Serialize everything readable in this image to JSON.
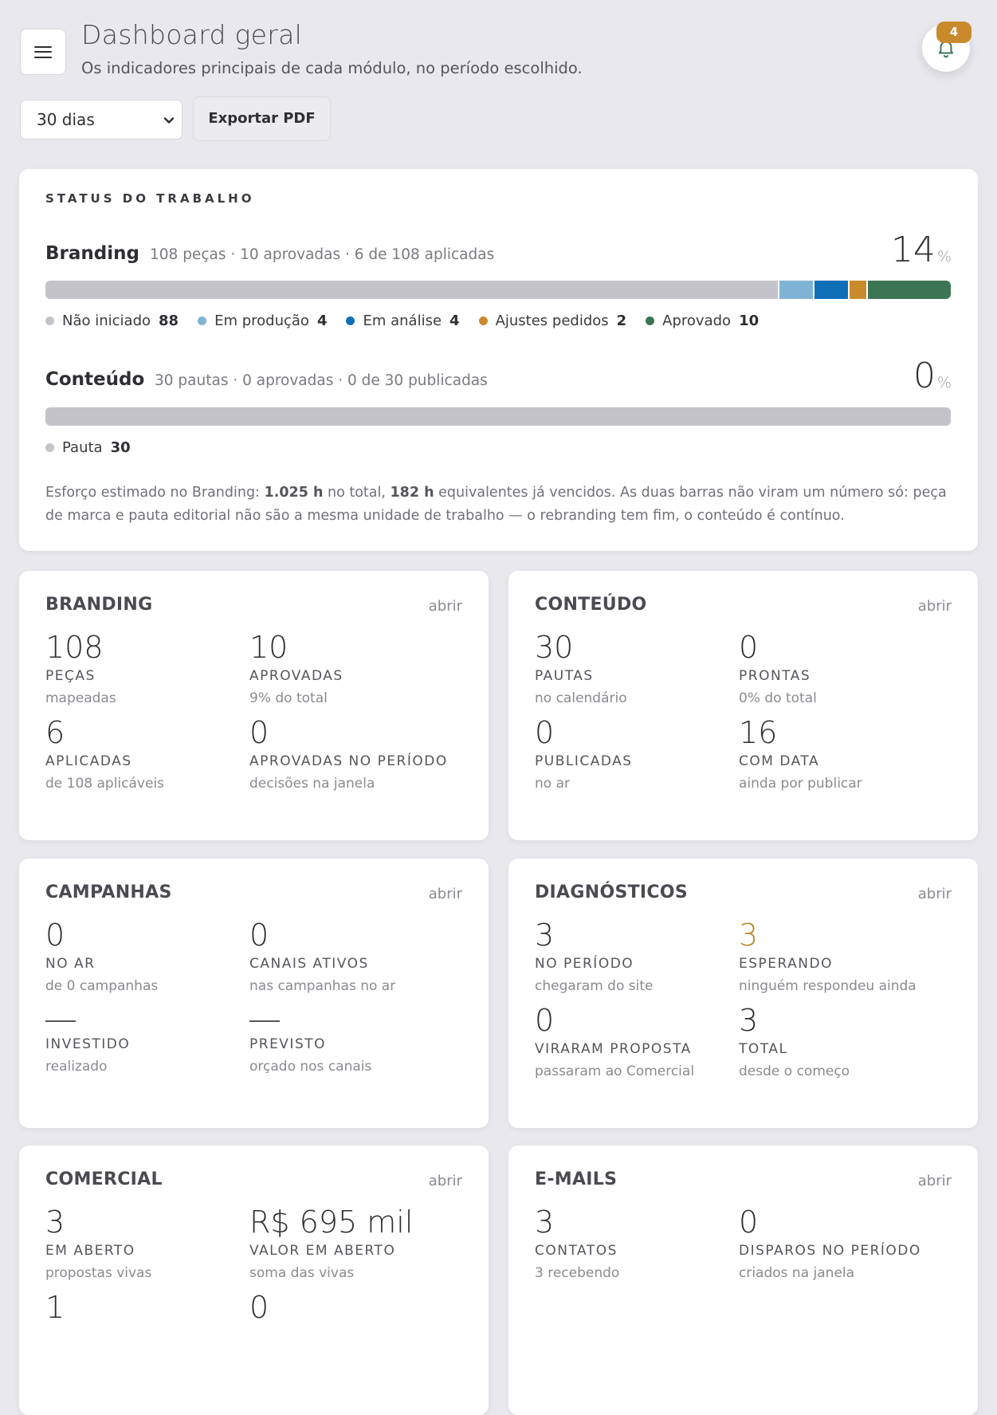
{
  "header": {
    "title": "Dashboard geral",
    "subtitle": "Os indicadores principais de cada módulo, no período escolhido.",
    "notifications_count": "4"
  },
  "controls": {
    "period_selected": "30 dias",
    "export_label": "Exportar PDF"
  },
  "status": {
    "section_label": "STATUS DO TRABALHO",
    "branding": {
      "title": "Branding",
      "summary": "108 peças · 10 aprovadas · 6 de 108 aplicadas",
      "percent": "14",
      "percent_sign": "%",
      "segments": [
        {
          "label": "Não iniciado",
          "count": 88,
          "color": "#c3c3c9"
        },
        {
          "label": "Em produção",
          "count": 4,
          "color": "#7fb3d6"
        },
        {
          "label": "Em análise",
          "count": 4,
          "color": "#0e6fb8"
        },
        {
          "label": "Ajustes pedidos",
          "count": 2,
          "color": "#c98a2c"
        },
        {
          "label": "Aprovado",
          "count": 10,
          "color": "#3c7553"
        }
      ]
    },
    "conteudo": {
      "title": "Conteúdo",
      "summary": "30 pautas · 0 aprovadas · 0 de 30 publicadas",
      "percent": "0",
      "percent_sign": "%",
      "segments": [
        {
          "label": "Pauta",
          "count": 30,
          "color": "#c3c3c9"
        }
      ]
    },
    "effort": {
      "prefix": "Esforço estimado no Branding: ",
      "total_hours": "1.025 h",
      "middle": " no total, ",
      "overdue_hours": "182 h",
      "suffix": " equivalentes já vencidos. As duas barras não viram um número só: peça de marca e pauta editorial não são a mesma unidade de trabalho — o rebranding tem fim, o conteúdo é contínuo."
    }
  },
  "modules": {
    "open_label": "abrir",
    "branding": {
      "title": "BRANDING",
      "metrics": [
        {
          "value": "108",
          "label": "PEÇAS",
          "hint": "mapeadas"
        },
        {
          "value": "10",
          "label": "APROVADAS",
          "hint": "9% do total"
        },
        {
          "value": "6",
          "label": "APLICADAS",
          "hint": "de 108 aplicáveis"
        },
        {
          "value": "0",
          "label": "APROVADAS NO PERÍODO",
          "hint": "decisões na janela"
        }
      ]
    },
    "conteudo": {
      "title": "CONTEÚDO",
      "metrics": [
        {
          "value": "30",
          "label": "PAUTAS",
          "hint": "no calendário"
        },
        {
          "value": "0",
          "label": "PRONTAS",
          "hint": "0% do total"
        },
        {
          "value": "0",
          "label": "PUBLICADAS",
          "hint": "no ar"
        },
        {
          "value": "16",
          "label": "COM DATA",
          "hint": "ainda por publicar"
        }
      ]
    },
    "campanhas": {
      "title": "CAMPANHAS",
      "metrics": [
        {
          "value": "0",
          "label": "NO AR",
          "hint": "de 0 campanhas"
        },
        {
          "value": "0",
          "label": "CANAIS ATIVOS",
          "hint": "nas campanhas no ar"
        },
        {
          "value": "",
          "label": "INVESTIDO",
          "hint": "realizado"
        },
        {
          "value": "",
          "label": "PREVISTO",
          "hint": "orçado nos canais"
        }
      ]
    },
    "diagnosticos": {
      "title": "DIAGNÓSTICOS",
      "accent_color": "#b88629",
      "metrics": [
        {
          "value": "3",
          "label": "NO PERÍODO",
          "hint": "chegaram do site"
        },
        {
          "value": "3",
          "label": "ESPERANDO",
          "hint": "ninguém respondeu ainda"
        },
        {
          "value": "0",
          "label": "VIRARAM PROPOSTA",
          "hint": "passaram ao Comercial"
        },
        {
          "value": "3",
          "label": "TOTAL",
          "hint": "desde o começo"
        }
      ]
    },
    "comercial": {
      "title": "COMERCIAL",
      "metrics": [
        {
          "value": "3",
          "label": "EM ABERTO",
          "hint": "propostas vivas"
        },
        {
          "value": "R$ 695 mil",
          "label": "VALOR EM ABERTO",
          "hint": "soma das vivas"
        },
        {
          "value": "1"
        },
        {
          "value": "0"
        }
      ]
    },
    "emails": {
      "title": "E-MAILS",
      "metrics": [
        {
          "value": "3",
          "label": "CONTATOS",
          "hint": "3 recebendo"
        },
        {
          "value": "0",
          "label": "DISPAROS NO PERÍODO",
          "hint": "criados na janela"
        }
      ]
    }
  }
}
